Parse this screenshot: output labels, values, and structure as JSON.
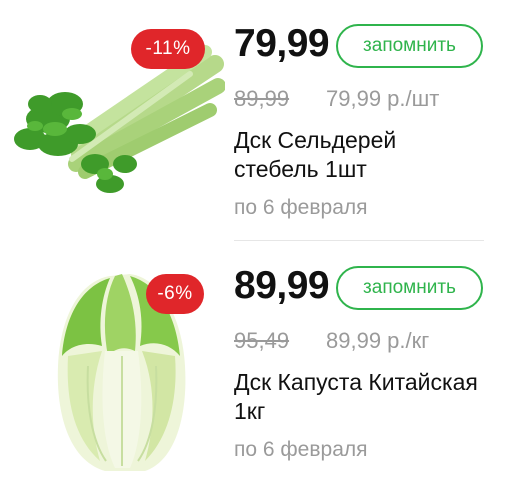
{
  "products": [
    {
      "discount": "-11%",
      "price": "79,99",
      "remember_label": "запомнить",
      "old_price": "89,99",
      "unit_price": "79,99 р./шт",
      "title": "Дск Сельдерей стебель 1шт",
      "valid_until": "по 6 февраля",
      "image_icon": "celery-image"
    },
    {
      "discount": "-6%",
      "price": "89,99",
      "remember_label": "запомнить",
      "old_price": "95,49",
      "unit_price": "89,99 р./кг",
      "title": "Дск Капуста Китайская 1кг",
      "valid_until": "по 6 февраля",
      "image_icon": "chinese-cabbage-image"
    }
  ],
  "colors": {
    "badge": "#e0262a",
    "accent_green": "#2fb44c",
    "muted_text": "#9a9a9a"
  }
}
